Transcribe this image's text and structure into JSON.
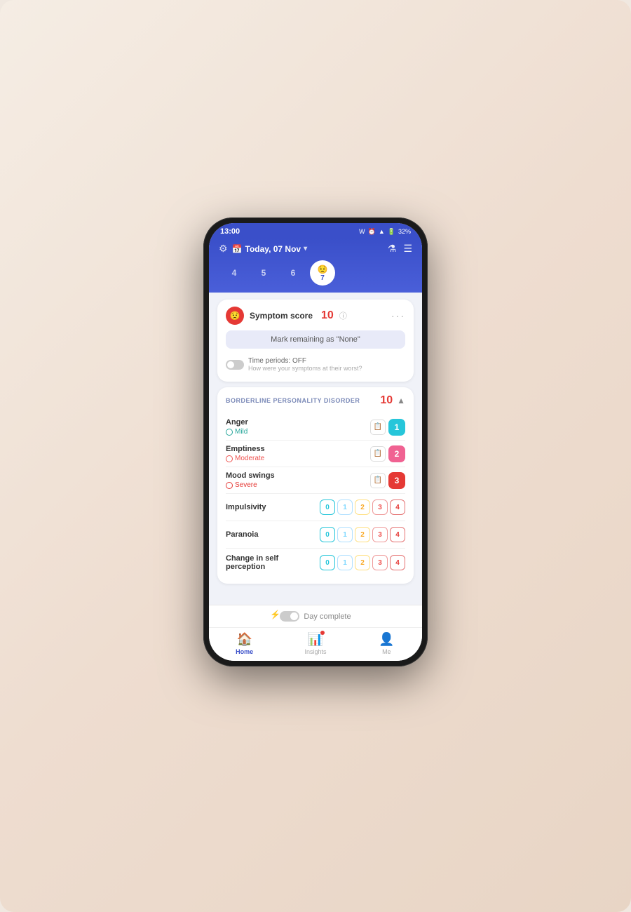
{
  "background": "#f0e8e0",
  "status_bar": {
    "time": "13:00",
    "icons": "W ⏰ ▲ 📶 🔋 32%"
  },
  "header": {
    "date": "Today, 07 Nov",
    "date_arrow": "▾",
    "gear_icon": "⚙",
    "flask_icon": "🧪",
    "menu_icon": "☰"
  },
  "days": [
    {
      "number": "4",
      "active": false
    },
    {
      "number": "5",
      "active": false
    },
    {
      "number": "6",
      "active": false
    },
    {
      "number": "7",
      "active": true,
      "emoji": "😟"
    }
  ],
  "score_card": {
    "score_label": "Symptom score",
    "score_value": "10",
    "mark_remaining": "Mark remaining as \"None\"",
    "time_periods_label": "Time periods: OFF",
    "time_periods_sub": "How were your symptoms at their worst?",
    "dots": "···"
  },
  "section": {
    "title": "BORDERLINE PERSONALITY DISORDER",
    "score": "10",
    "symptoms": [
      {
        "name": "Anger",
        "level": "Mild",
        "level_class": "level-mild",
        "badge_value": "1",
        "badge_class": "badge-teal"
      },
      {
        "name": "Emptiness",
        "level": "Moderate",
        "level_class": "level-moderate",
        "badge_value": "2",
        "badge_class": "badge-pink"
      },
      {
        "name": "Mood swings",
        "level": "Severe",
        "level_class": "level-severe",
        "badge_value": "3",
        "badge_class": "badge-red"
      }
    ],
    "rating_symptoms": [
      {
        "name": "Impulsivity",
        "buttons": [
          "0",
          "1",
          "2",
          "3",
          "4"
        ]
      },
      {
        "name": "Paranoia",
        "buttons": [
          "0",
          "1",
          "2",
          "3",
          "4"
        ]
      },
      {
        "name": "Change in self perception",
        "buttons": [
          "0",
          "1",
          "2",
          "3",
          "4"
        ]
      }
    ]
  },
  "day_complete": {
    "label": "Day complete"
  },
  "nav": {
    "items": [
      {
        "icon": "🏠",
        "label": "Home",
        "active": true
      },
      {
        "icon": "📊",
        "label": "Insights",
        "active": false,
        "badge": true
      },
      {
        "icon": "👤",
        "label": "Me",
        "active": false
      }
    ]
  }
}
